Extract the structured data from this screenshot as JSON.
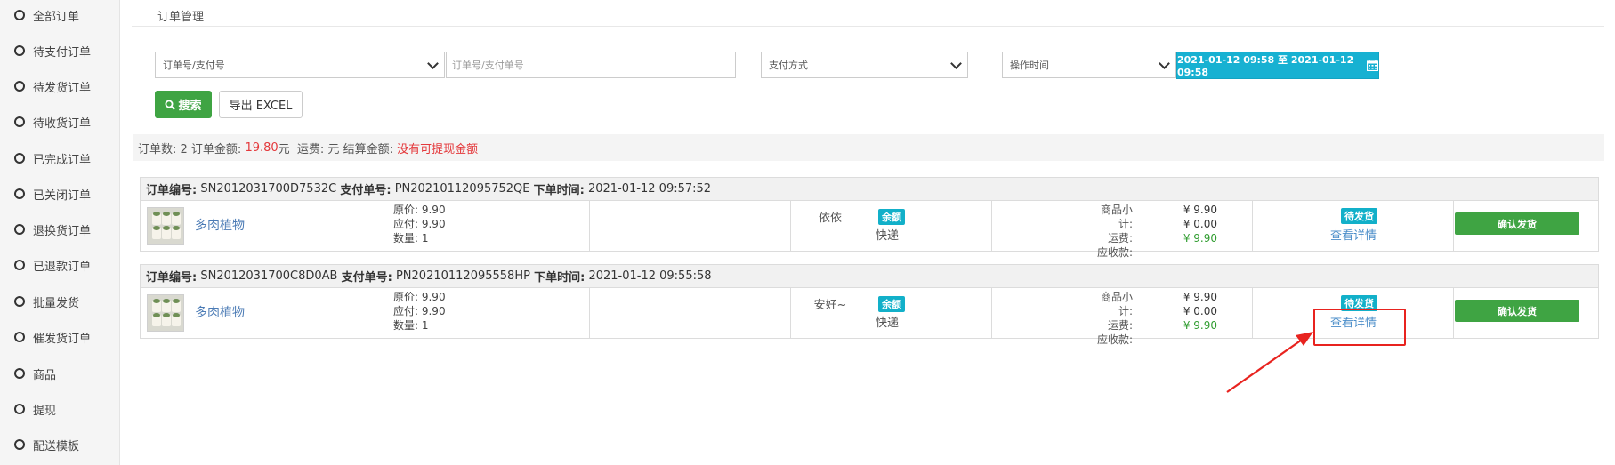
{
  "sidebar": {
    "items": [
      {
        "label": "全部订单"
      },
      {
        "label": "待支付订单"
      },
      {
        "label": "待发货订单"
      },
      {
        "label": "待收货订单"
      },
      {
        "label": "已完成订单"
      },
      {
        "label": "已关闭订单"
      },
      {
        "label": "退换货订单"
      },
      {
        "label": "已退款订单"
      },
      {
        "label": "批量发货"
      },
      {
        "label": "催发货订单"
      },
      {
        "label": "商品"
      },
      {
        "label": "提现"
      },
      {
        "label": "配送模板"
      }
    ]
  },
  "page": {
    "title": "订单管理"
  },
  "filters": {
    "order_type_select": "订单号/支付号",
    "order_input_placeholder": "订单号/支付单号",
    "payment_select": "支付方式",
    "time_select": "操作时间",
    "date_range": "2021-01-12 09:58 至 2021-01-12 09:58"
  },
  "buttons": {
    "search": "搜索",
    "export": "导出 EXCEL"
  },
  "summary": {
    "count_label": "订单数: 2 订单金额: ",
    "amount": "19.80",
    "amount_unit": "元  运费: 元 结算金额: ",
    "withdraw_note": "没有可提现金额"
  },
  "orders": [
    {
      "labels": {
        "order_no": "订单编号:",
        "pay_no": "支付单号:",
        "time": "下单时间:"
      },
      "order_no": "SN2012031700D7532C",
      "pay_no": "PN20210112095752QE",
      "time": "2021-01-12 09:57:52",
      "product_name": "多肉植物",
      "price_lines": [
        "原价: 9.90",
        "应付: 9.90",
        "数量: 1"
      ],
      "buyer_note": "依依",
      "pay_badge": "余额",
      "ship_method": "快递",
      "sum_labels": [
        "商品小计:",
        "运费:",
        "应收款:"
      ],
      "sum_values": [
        "¥ 9.90",
        "¥ 0.00",
        "¥ 9.90"
      ],
      "status": "待发货",
      "detail_link": "查看详情",
      "action": "确认发货"
    },
    {
      "labels": {
        "order_no": "订单编号:",
        "pay_no": "支付单号:",
        "time": "下单时间:"
      },
      "order_no": "SN2012031700C8D0AB",
      "pay_no": "PN20210112095558HP",
      "time": "2021-01-12 09:55:58",
      "product_name": "多肉植物",
      "price_lines": [
        "原价: 9.90",
        "应付: 9.90",
        "数量: 1"
      ],
      "buyer_note": "安好~",
      "pay_badge": "余额",
      "ship_method": "快递",
      "sum_labels": [
        "商品小计:",
        "运费:",
        "应收款:"
      ],
      "sum_values": [
        "¥ 9.90",
        "¥ 0.00",
        "¥ 9.90"
      ],
      "status": "待发货",
      "detail_link": "查看详情",
      "action": "确认发货"
    }
  ],
  "colors": {
    "accent_cyan": "#17b1d2",
    "green": "#3fa443",
    "red": "#e4393c",
    "annotation": "#e8231f"
  }
}
